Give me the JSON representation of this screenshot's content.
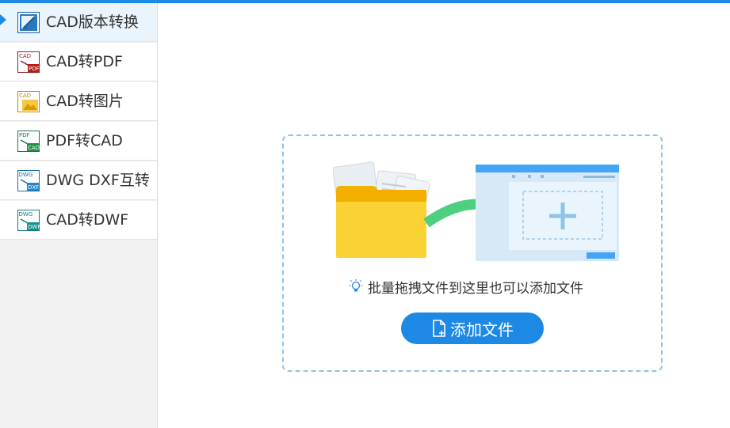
{
  "sidebar": {
    "items": [
      {
        "label": "CAD版本转换",
        "icon": "cad-version-convert-icon",
        "active": true
      },
      {
        "label": "CAD转PDF",
        "icon": "cad-to-pdf-icon",
        "active": false
      },
      {
        "label": "CAD转图片",
        "icon": "cad-to-image-icon",
        "active": false
      },
      {
        "label": "PDF转CAD",
        "icon": "pdf-to-cad-icon",
        "active": false
      },
      {
        "label": "DWG DXF互转",
        "icon": "dwg-dxf-convert-icon",
        "active": false
      },
      {
        "label": "CAD转DWF",
        "icon": "cad-to-dwf-icon",
        "active": false
      }
    ],
    "icon_text": {
      "cad": "CAD",
      "pdf": "PDF",
      "dwg": "DWG",
      "dxf": "DXF",
      "dwf": "DWF"
    }
  },
  "dropzone": {
    "hint": "批量拖拽文件到这里也可以添加文件",
    "add_button_label": "添加文件"
  },
  "colors": {
    "accent": "#1e88e5",
    "dropzone_border": "#8ec5ea",
    "folder_yellow": "#f7c21b",
    "arrow_green": "#4cd080"
  }
}
